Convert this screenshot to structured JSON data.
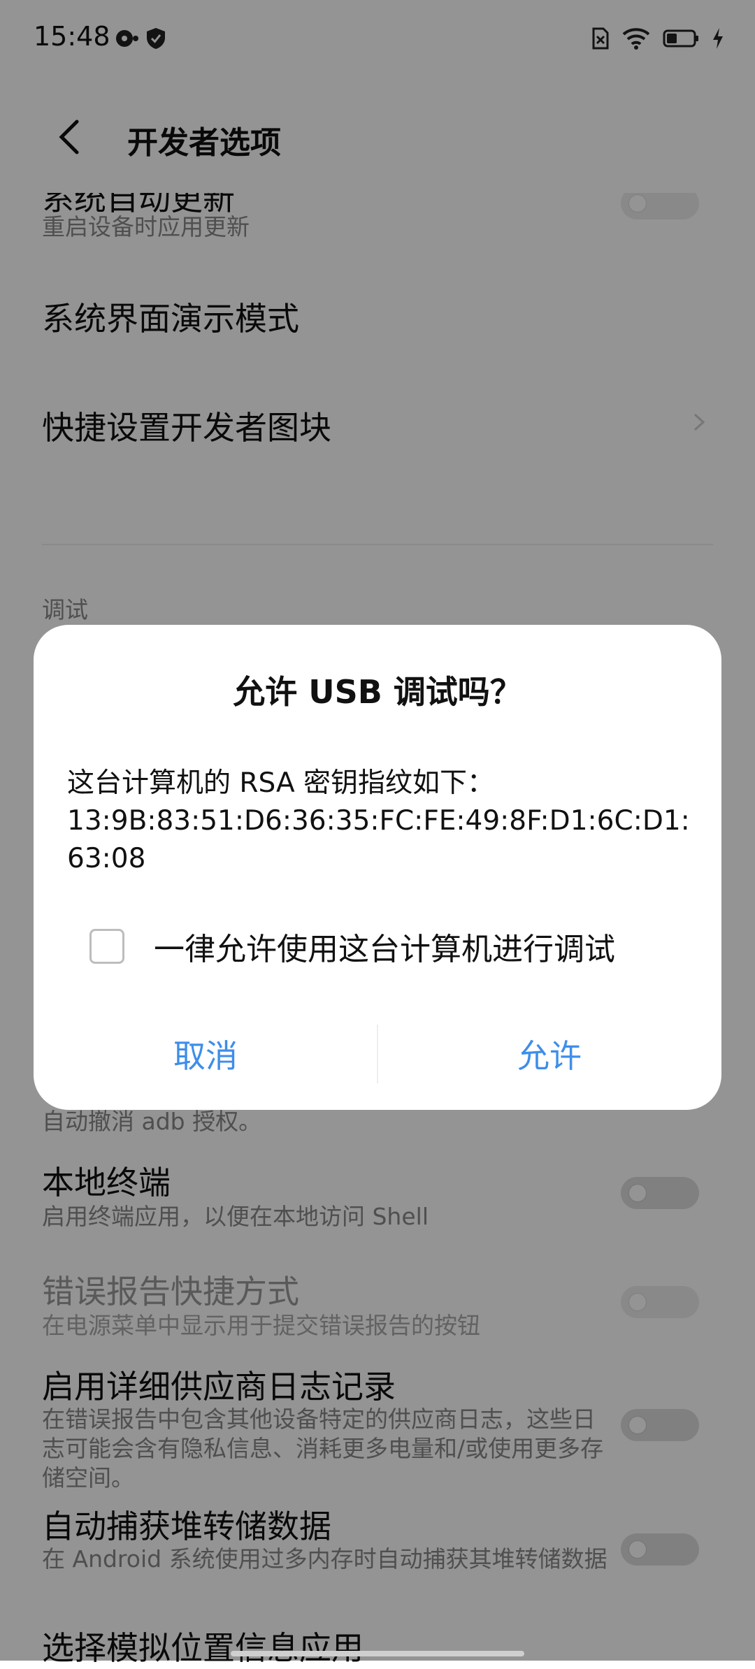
{
  "status_bar": {
    "time": "15:48"
  },
  "header": {
    "title": "开发者选项"
  },
  "list": {
    "top_partial_title": "系统自动更新",
    "top_partial_subtitle": "重启设备时应用更新",
    "demo_mode": "系统界面演示模式",
    "quick_tiles": "快捷设置开发者图块",
    "section_debug": "调试",
    "revoke_partial_subtitle": "自动撤消 adb 授权。",
    "local_terminal_title": "本地终端",
    "local_terminal_subtitle": "启用终端应用，以便在本地访问 Shell",
    "bug_report_title": "错误报告快捷方式",
    "bug_report_subtitle": "在电源菜单中显示用于提交错误报告的按钮",
    "vendor_log_title": "启用详细供应商日志记录",
    "vendor_log_subtitle": "在错误报告中包含其他设备特定的供应商日志，这些日志可能会含有隐私信息、消耗更多电量和/或使用更多存储空间。",
    "heap_dump_title": "自动捕获堆转储数据",
    "heap_dump_subtitle": "在 Android 系统使用过多内存时自动捕获其堆转储数据",
    "mock_location_title": "选择模拟位置信息应用"
  },
  "dialog": {
    "title": "允许 USB 调试吗？",
    "message_line1": "这台计算机的 RSA 密钥指纹如下：",
    "message_line2": "13:9B:83:51:D6:36:35:FC:FE:49:8F:D1:6C:D1:",
    "message_line3": "63:08",
    "checkbox_label": "一律允许使用这台计算机进行调试",
    "checkbox_checked": false,
    "cancel_label": "取消",
    "allow_label": "允许",
    "accent_color": "#3d8eea"
  }
}
